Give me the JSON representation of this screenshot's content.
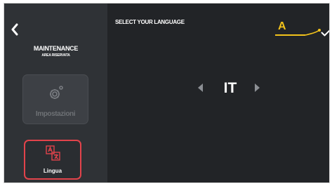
{
  "sidebar": {
    "back_icon": "chevron-left-icon",
    "title": "MAINTENANCE",
    "subtitle": "AREA RISERVATA",
    "items": [
      {
        "label": "Impostazioni",
        "icon": "gear-icon",
        "state": "disabled"
      },
      {
        "label": "Lingua",
        "icon": "translate-icon",
        "state": "selected"
      }
    ]
  },
  "main": {
    "heading": "SELECT YOUR LANGUAGE",
    "language_code": "IT",
    "prev_icon": "caret-left-icon",
    "next_icon": "caret-right-icon",
    "confirm_icon": "checkmark-icon"
  },
  "annotation": {
    "letter": "A"
  },
  "colors": {
    "background": "#222427",
    "sidebar": "#2f3236",
    "accent_red": "#e2434b",
    "annotation_yellow": "#f2c21b"
  }
}
